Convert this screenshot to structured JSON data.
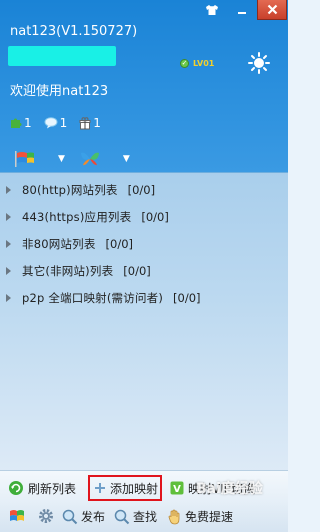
{
  "window": {
    "title": "nat123(V1.150727)"
  },
  "account": {
    "username": "",
    "level_badge": "LV01",
    "welcome_text": "欢迎使用nat123"
  },
  "stats": [
    {
      "icon": "puzzle-icon",
      "value": "1"
    },
    {
      "icon": "chat-bubble-icon",
      "value": "1"
    },
    {
      "icon": "gift-icon",
      "value": "1"
    }
  ],
  "tree": [
    {
      "label": "80(http)网站列表",
      "count": "[0/0]"
    },
    {
      "label": "443(https)应用列表",
      "count": "[0/0]"
    },
    {
      "label": "非80网站列表",
      "count": "[0/0]"
    },
    {
      "label": "其它(非网站)列表",
      "count": "[0/0]"
    },
    {
      "label": "p2p 全端口映射(需访问者)",
      "count": "[0/0]"
    }
  ],
  "toolbar": {
    "refresh_label": "刷新列表",
    "add_label": "添加映射",
    "switch_label": "映射VIP切换"
  },
  "bottombar": {
    "publish_label": "发布",
    "find_label": "查找",
    "speed_label": "免费提速"
  },
  "watermark": "Bai度经验",
  "colors": {
    "header": "#1a83d6",
    "highlight_border": "#e0141c",
    "username_mask": "#19f0e6"
  }
}
